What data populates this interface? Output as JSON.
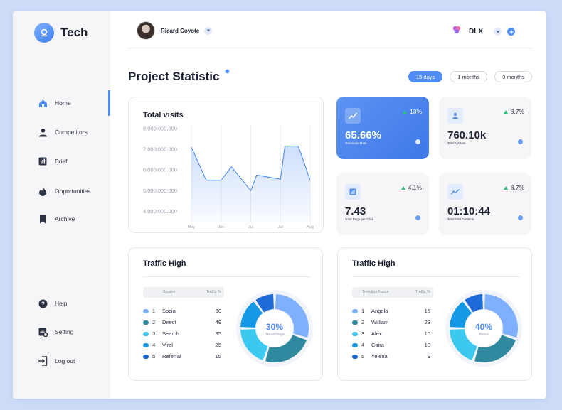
{
  "brand": {
    "name": "Tech"
  },
  "sidebar": {
    "items": [
      {
        "label": "Home",
        "icon": "home-icon"
      },
      {
        "label": "Competitors",
        "icon": "user-icon"
      },
      {
        "label": "Brief",
        "icon": "chart-icon"
      },
      {
        "label": "Opportunities",
        "icon": "flame-icon"
      },
      {
        "label": "Archive",
        "icon": "bookmark-icon"
      }
    ],
    "bottom_items": [
      {
        "label": "Help",
        "icon": "help-icon"
      },
      {
        "label": "Setting",
        "icon": "settings-icon"
      },
      {
        "label": "Log out",
        "icon": "logout-icon"
      }
    ]
  },
  "header": {
    "user_name": "Ricard Coyote",
    "org_name": "DLX"
  },
  "page": {
    "title": "Project Statistic",
    "tabs": [
      {
        "label": "15 days",
        "active": true
      },
      {
        "label": "1 months",
        "active": false
      },
      {
        "label": "3 months",
        "active": false
      }
    ]
  },
  "visits": {
    "title": "Total visits",
    "chart_data": {
      "type": "area",
      "title": "Total visits",
      "categories": [
        "May",
        "Jun",
        "Jul",
        "Jul",
        "Aug"
      ],
      "ytick_labels": [
        "8.000.000.000",
        "7.000.000.000",
        "6.000.000.000",
        "5.000.000.000",
        "4.000.000.000"
      ],
      "ylim": [
        3500000000,
        8200000000
      ],
      "points": [
        {
          "x": 0.0,
          "y": 7100000000
        },
        {
          "x": 0.5,
          "y": 5500000000
        },
        {
          "x": 1.0,
          "y": 5500000000
        },
        {
          "x": 1.35,
          "y": 6150000000
        },
        {
          "x": 2.0,
          "y": 5000000000
        },
        {
          "x": 2.2,
          "y": 5750000000
        },
        {
          "x": 3.0,
          "y": 5550000000
        },
        {
          "x": 3.15,
          "y": 7150000000
        },
        {
          "x": 3.6,
          "y": 7150000000
        },
        {
          "x": 4.0,
          "y": 5500000000
        }
      ],
      "color": "#4f8df5"
    }
  },
  "stats": [
    {
      "value": "65.66%",
      "label": "Terminate Rate",
      "change": "13%",
      "icon": "trend-icon"
    },
    {
      "value": "760.10k",
      "label": "Total Visitors",
      "change": "8.7%",
      "icon": "person-icon"
    },
    {
      "value": "7.43",
      "label": "Total Page per Click",
      "change": "4.1%",
      "icon": "bar-chart-icon"
    },
    {
      "value": "01:10:44",
      "label": "Total Visit Duration",
      "change": "8.7%",
      "icon": "line-chart-icon"
    }
  ],
  "traffic": [
    {
      "title": "Traffic High",
      "col_name": "Source",
      "col_value": "Traffic %",
      "center_value": "30%",
      "center_label": "Presentage",
      "rows": [
        {
          "num": "1",
          "name": "Social",
          "value": "60",
          "color": "#7fb0ff"
        },
        {
          "num": "2",
          "name": "Direct",
          "value": "49",
          "color": "#2f8aa0"
        },
        {
          "num": "3",
          "name": "Search",
          "value": "35",
          "color": "#3cc9f0"
        },
        {
          "num": "4",
          "name": "Viral",
          "value": "25",
          "color": "#1598e6"
        },
        {
          "num": "5",
          "name": "Referral",
          "value": "15",
          "color": "#1e6ad8"
        }
      ],
      "slices": [
        30,
        25,
        20,
        15,
        10
      ]
    },
    {
      "title": "Traffic High",
      "col_name": "Trending Name",
      "col_value": "Traffic %",
      "center_value": "40%",
      "center_label": "Alexa",
      "rows": [
        {
          "num": "1",
          "name": "Angela",
          "value": "15",
          "color": "#7fb0ff"
        },
        {
          "num": "2",
          "name": "William",
          "value": "23",
          "color": "#2f8aa0"
        },
        {
          "num": "3",
          "name": "Alex",
          "value": "10",
          "color": "#3cc9f0"
        },
        {
          "num": "4",
          "name": "Caira",
          "value": "18",
          "color": "#1598e6"
        },
        {
          "num": "5",
          "name": "Yelena",
          "value": "9",
          "color": "#1e6ad8"
        }
      ],
      "slices": [
        30,
        25,
        20,
        15,
        10
      ]
    }
  ]
}
